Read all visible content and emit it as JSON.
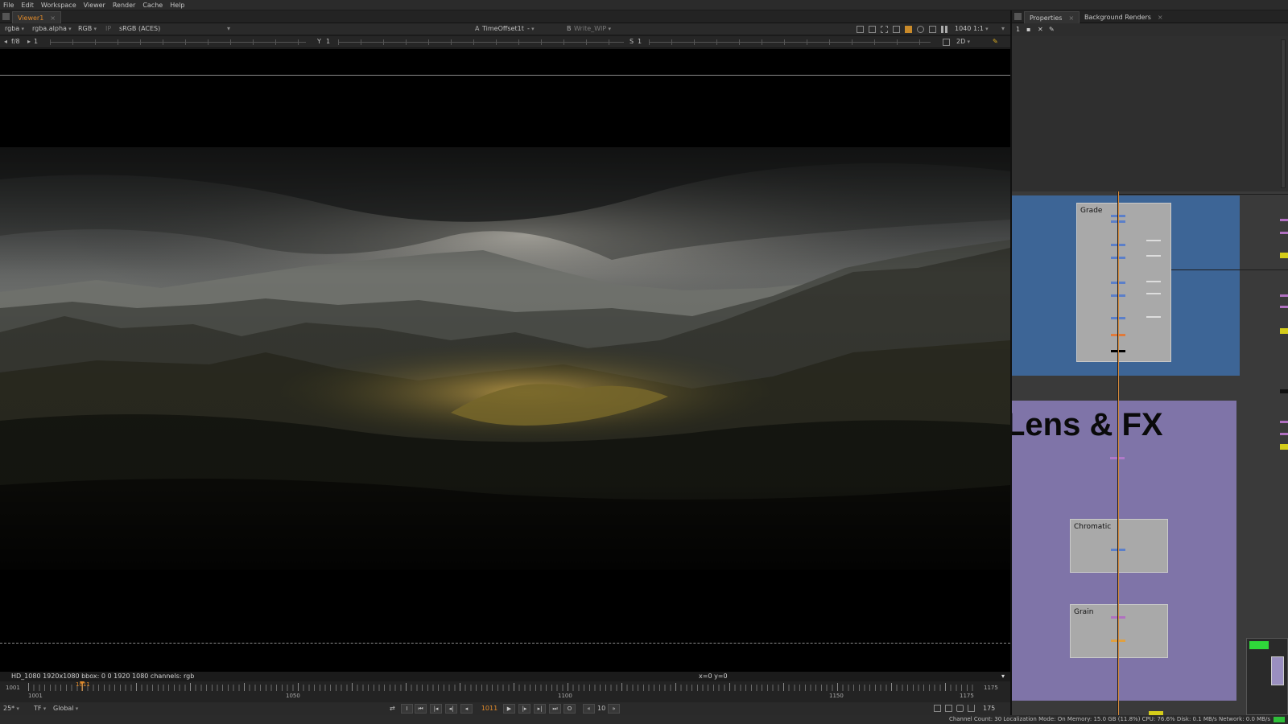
{
  "menu": [
    "File",
    "Edit",
    "Workspace",
    "Viewer",
    "Render",
    "Cache",
    "Help"
  ],
  "viewer": {
    "tab_label": "Viewer1",
    "channels": "rgba",
    "alpha": "rgba.alpha",
    "display": "RGB",
    "ip": "IP",
    "colorspace": "sRGB (ACES)",
    "input_a_prefix": "A",
    "input_a": "TimeOffset1t",
    "input_a_op": "-",
    "input_b_prefix": "B",
    "input_b": "Write_WIP",
    "zoom": "1:1",
    "resolution": "1040",
    "gain_label": "f/8",
    "gain_value": "1",
    "gamma_label": "Y",
    "gamma_value": "1",
    "saturation_label": "S",
    "saturation_value": "1",
    "view_mode": "2D",
    "info_left": "HD_1080 1920x1080  bbox: 0 0 1920 1080 channels: rgb",
    "info_coords": "x=0 y=0"
  },
  "timeline": {
    "start": "1001",
    "end": "1175",
    "current": "1011",
    "marks": [
      "1001",
      "1050",
      "1100",
      "1150",
      "1175"
    ],
    "fps": "25*",
    "tf": "TF",
    "range_mode": "Global",
    "frame_field": "1011",
    "step": "10",
    "end_field": "175",
    "playhead_fraction": 0.057
  },
  "playback_icons": [
    "loop-icon",
    "in-point-icon",
    "first-frame-icon",
    "prev-keyframe-icon",
    "step-back-icon",
    "play-back-icon",
    "play-forward-icon",
    "step-forward-icon",
    "next-keyframe-icon",
    "last-frame-icon",
    "out-point-icon"
  ],
  "properties": {
    "tabs": [
      "Properties",
      "Background Renders"
    ],
    "count": "1"
  },
  "node_graph": {
    "backdrops": [
      {
        "label": "Grade",
        "color": "#3d6596"
      },
      {
        "label": "Lens & FX",
        "color": "#7f74a8"
      }
    ],
    "nodes": [
      "Grade",
      "Chromatic",
      "Grain"
    ]
  },
  "status": "Channel Count: 30  Localization Mode: On  Memory: 15.0 GB (11.8%)  CPU: 76.6%  Disk: 0.1 MB/s  Network: 0.0 MB/s",
  "colors": {
    "accent": "#e08a2a",
    "grade_backdrop": "#3d6596",
    "lens_backdrop": "#7f74a8"
  }
}
